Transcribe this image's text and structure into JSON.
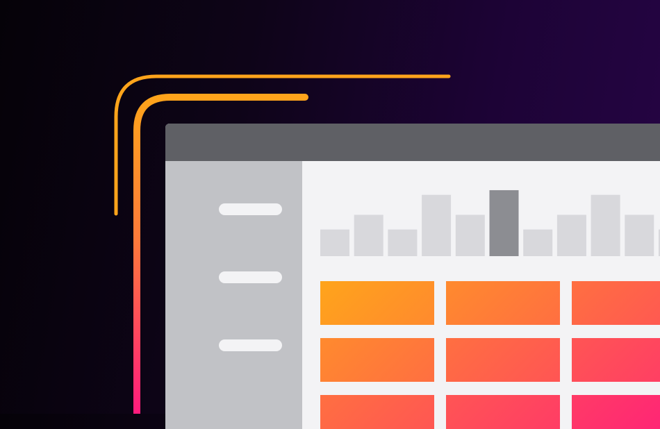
{
  "colors": {
    "accent_orange": "#ffa41b",
    "accent_magenta": "#ff1b7d",
    "titlebar": "#5f6065",
    "sidebar": "#c1c2c6",
    "content": "#f3f3f5",
    "bar": "#d8d8dc",
    "bar_active": "#8c8d92"
  },
  "sidebar": {
    "items": [
      {
        "icon": "menu-placeholder"
      },
      {
        "icon": "menu-placeholder"
      },
      {
        "icon": "menu-placeholder"
      }
    ]
  },
  "chart_data": {
    "type": "bar",
    "title": "",
    "xlabel": "",
    "ylabel": "",
    "values": [
      40,
      62,
      40,
      92,
      62,
      99,
      40,
      62,
      92,
      62,
      40
    ],
    "highlight_index": 5,
    "ylim": [
      0,
      100
    ]
  },
  "grid": {
    "rows": 3,
    "cols": 3,
    "gradient_from": "#ffa41b",
    "gradient_to": "#ff1b7d"
  }
}
